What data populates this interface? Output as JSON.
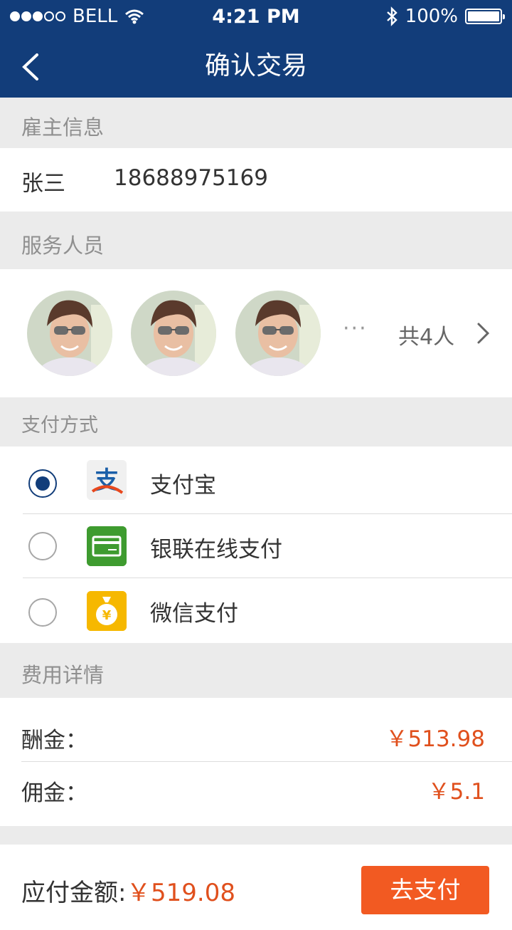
{
  "status_bar": {
    "carrier": "BELL",
    "time": "4:21 PM",
    "battery": "100%"
  },
  "nav": {
    "title": "确认交易",
    "back_icon": "chevron-left-icon"
  },
  "employer": {
    "section_title": "雇主信息",
    "name": "张三",
    "phone": "18688975169"
  },
  "staff": {
    "section_title": "服务人员",
    "more": "···",
    "count_text": "共4人",
    "arrow_icon": "chevron-right-icon"
  },
  "payment": {
    "section_title": "支付方式",
    "options": [
      {
        "label": "支付宝",
        "icon": "alipay-icon",
        "selected": true
      },
      {
        "label": "银联在线支付",
        "icon": "unionpay-card-icon",
        "selected": false
      },
      {
        "label": "微信支付",
        "icon": "money-bag-icon",
        "selected": false
      }
    ]
  },
  "fees": {
    "section_title": "费用详情",
    "items": [
      {
        "label": "酬金：",
        "value": "￥513.98"
      },
      {
        "label": "佣金：",
        "value": "￥5.1"
      }
    ]
  },
  "footer": {
    "total_label": "应付金额:",
    "total_value": "￥519.08",
    "pay_button": "去支付"
  },
  "colors": {
    "primary": "#123d7a",
    "accent": "#f25a22",
    "price": "#e0501d"
  }
}
